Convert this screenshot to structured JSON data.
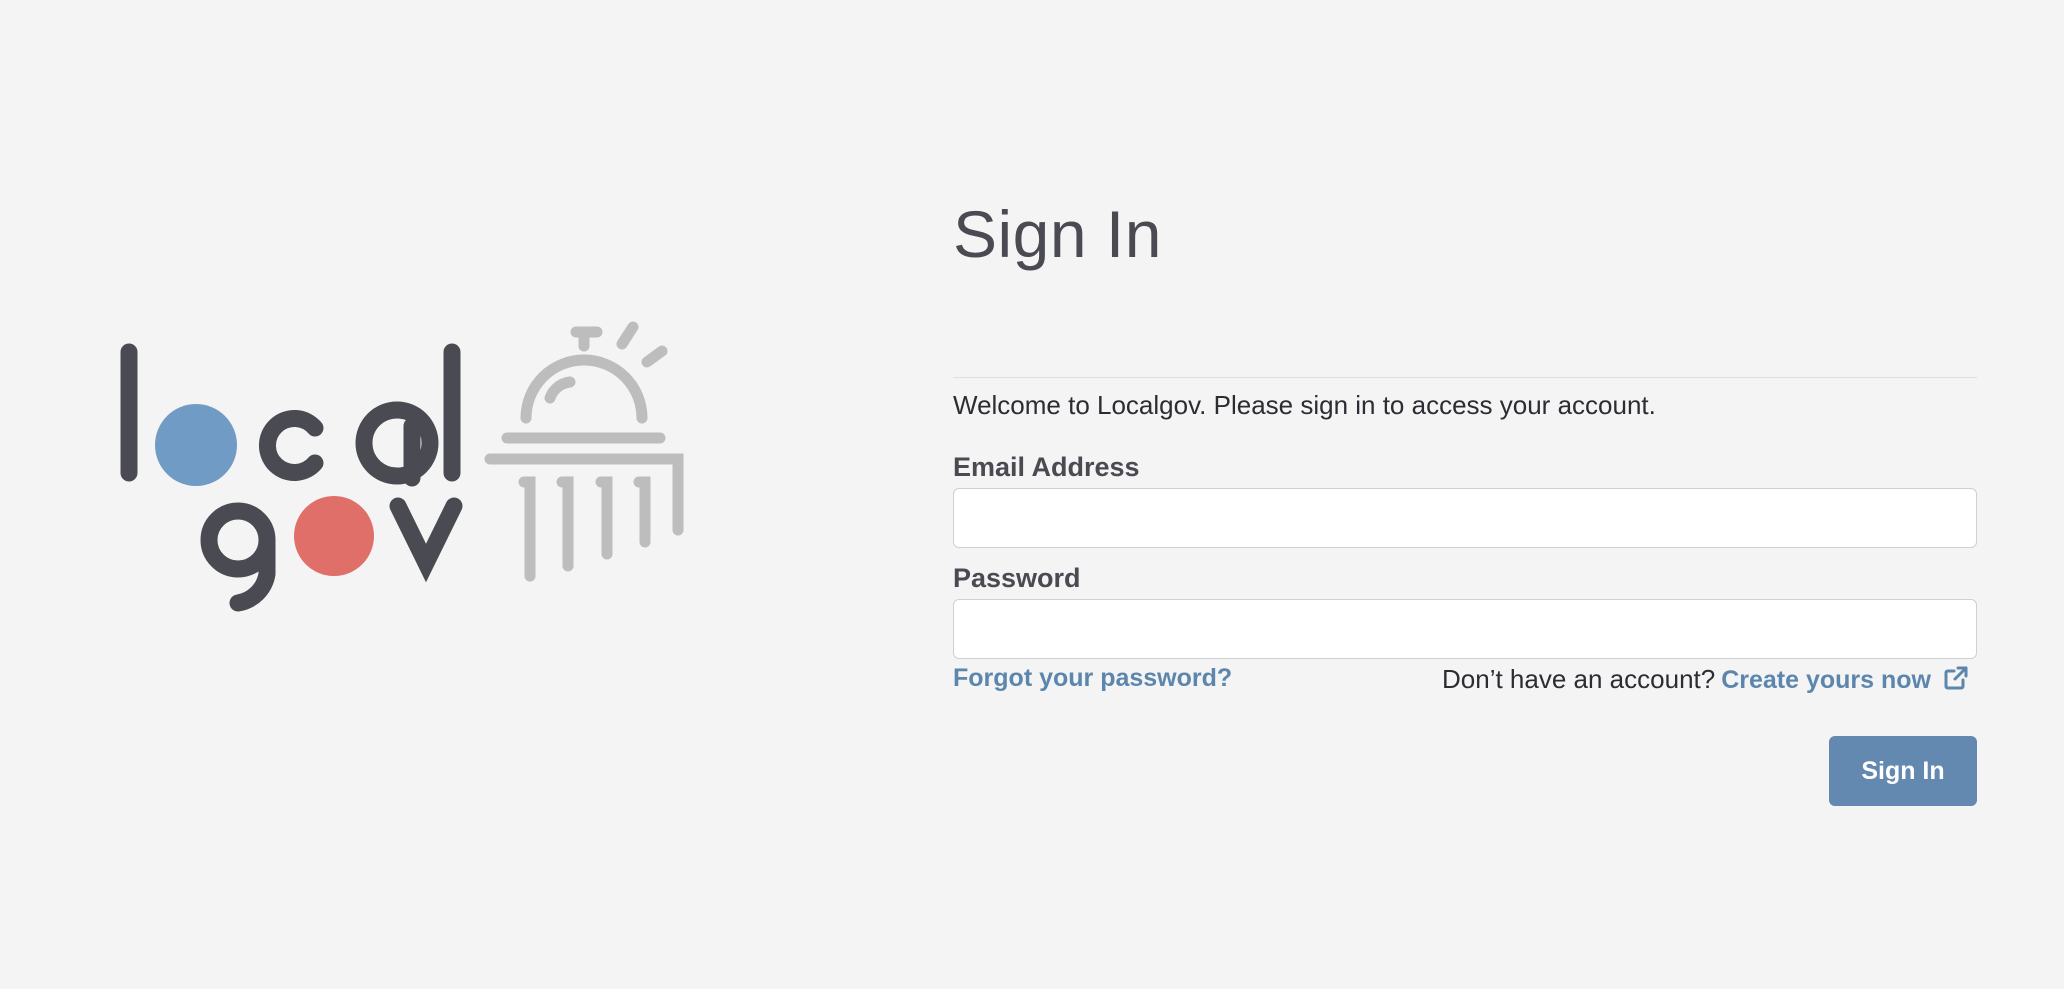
{
  "brand": {
    "name_line1": "local",
    "name_line2": "gov",
    "colors": {
      "text": "#4a4b52",
      "blue_dot": "#6f9bc4",
      "red_dot": "#df6f68",
      "icon": "#bdbdbd"
    }
  },
  "signin": {
    "title": "Sign In",
    "welcome": "Welcome to Localgov. Please sign in to access your account.",
    "email_label": "Email Address",
    "email_value": "",
    "password_label": "Password",
    "password_value": "",
    "forgot_link": "Forgot your password?",
    "signup_prompt": "Don’t have an account?",
    "signup_link": "Create yours now",
    "signup_icon": "external-link-icon",
    "submit_label": "Sign In"
  },
  "colors": {
    "background": "#f4f4f4",
    "accent": "#6389b0",
    "link": "#5d86ad",
    "heading": "#4a4b52"
  }
}
